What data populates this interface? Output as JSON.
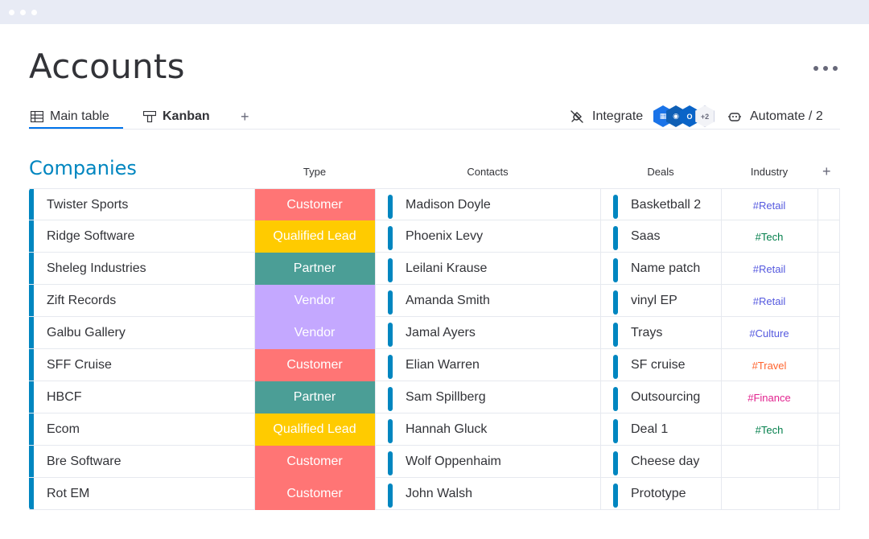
{
  "page": {
    "title": "Accounts"
  },
  "tabs": {
    "main_table": "Main table",
    "kanban": "Kanban",
    "add": "+"
  },
  "toolbar": {
    "integrate": "Integrate",
    "integrations_more": "+2",
    "automate": "Automate / 2"
  },
  "group": {
    "title": "Companies",
    "color": "#0086c0"
  },
  "columns": {
    "type": "Type",
    "contacts": "Contacts",
    "deals": "Deals",
    "industry": "Industry",
    "add": "+"
  },
  "status_colors": {
    "Customer": "#ff7575",
    "Qualified Lead": "#ffcb00",
    "Partner": "#4b9e96",
    "Vendor": "#c4a8ff"
  },
  "industry_colors": {
    "#Retail": "#5559df",
    "#Tech": "#037f4c",
    "#Culture": "#5559df",
    "#Travel": "#ff642e",
    "#Finance": "#e2238f"
  },
  "rows": [
    {
      "name": "Twister Sports",
      "type": "Customer",
      "contact": "Madison Doyle",
      "deal": "Basketball 2",
      "industry": "#Retail"
    },
    {
      "name": "Ridge Software",
      "type": "Qualified Lead",
      "contact": "Phoenix Levy",
      "deal": "Saas",
      "industry": "#Tech"
    },
    {
      "name": "Sheleg Industries",
      "type": "Partner",
      "contact": "Leilani Krause",
      "deal": "Name patch",
      "industry": "#Retail"
    },
    {
      "name": "Zift Records",
      "type": "Vendor",
      "contact": "Amanda Smith",
      "deal": "vinyl EP",
      "industry": "#Retail"
    },
    {
      "name": "Galbu Gallery",
      "type": "Vendor",
      "contact": "Jamal Ayers",
      "deal": "Trays",
      "industry": "#Culture"
    },
    {
      "name": "SFF Cruise",
      "type": "Customer",
      "contact": "Elian Warren",
      "deal": "SF cruise",
      "industry": "#Travel"
    },
    {
      "name": "HBCF",
      "type": "Partner",
      "contact": "Sam Spillberg",
      "deal": "Outsourcing",
      "industry": "#Finance"
    },
    {
      "name": "Ecom",
      "type": "Qualified Lead",
      "contact": "Hannah Gluck",
      "deal": "Deal 1",
      "industry": "#Tech"
    },
    {
      "name": "Bre Software",
      "type": "Customer",
      "contact": "Wolf Oppenhaim",
      "deal": "Cheese day",
      "industry": ""
    },
    {
      "name": "Rot EM",
      "type": "Customer",
      "contact": "John Walsh",
      "deal": "Prototype",
      "industry": ""
    }
  ]
}
